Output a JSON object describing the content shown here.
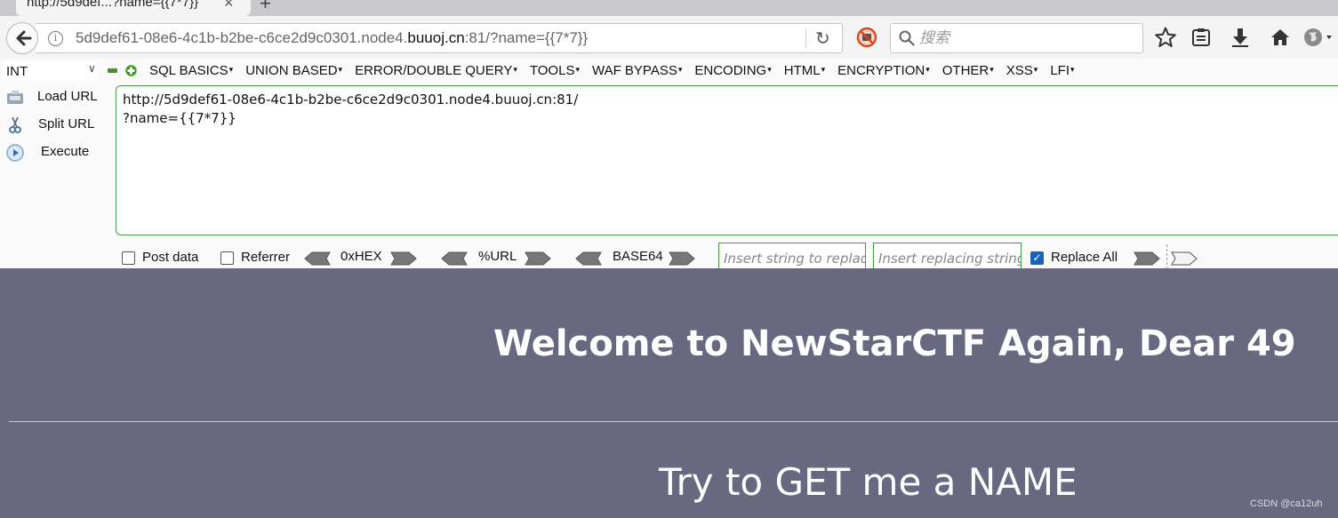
{
  "browser": {
    "tab_title": "http://5d9def...?name={{7*7}}",
    "url": {
      "prefix": "5d9def61-08e6-4c1b-b2be-c6ce2d9c0301.node4.",
      "domain": "buuoj.cn",
      "suffix": ":81/?name={{7*7}}"
    },
    "search_placeholder": "搜索",
    "icons": [
      "back-arrow-icon",
      "info-icon",
      "reload-icon",
      "block-icon",
      "search-icon",
      "star-icon",
      "reader-icon",
      "download-icon",
      "home-icon",
      "globe-icon"
    ]
  },
  "hackbar": {
    "select_value": "INT",
    "menu": [
      {
        "label": "SQL BASICS"
      },
      {
        "label": "UNION BASED"
      },
      {
        "label": "ERROR/DOUBLE QUERY"
      },
      {
        "label": "TOOLS"
      },
      {
        "label": "WAF BYPASS"
      },
      {
        "label": "ENCODING"
      },
      {
        "label": "HTML"
      },
      {
        "label": "ENCRYPTION"
      },
      {
        "label": "OTHER"
      },
      {
        "label": "XSS"
      },
      {
        "label": "LFI"
      }
    ],
    "side": {
      "load_url": "Load URL",
      "split_url": "Split URL",
      "execute": "Execute"
    },
    "textarea": "http://5d9def61-08e6-4c1b-b2be-c6ce2d9c0301.node4.buuoj.cn:81/\n?name={{7*7}}",
    "bottom": {
      "post_data": "Post data",
      "referrer": "Referrer",
      "hex": "0xHEX",
      "url": "%URL",
      "base64": "BASE64",
      "find_placeholder": "Insert string to replace",
      "replace_placeholder": "Insert replacing string",
      "replace_all": "Replace All",
      "replace_all_checked": true
    },
    "colors": {
      "accent_green": "#3d9a3d",
      "checkbox_blue": "#1565c0"
    }
  },
  "page": {
    "welcome": "Welcome to NewStarCTF Again, Dear 49",
    "subtitle": "Try to GET me a NAME",
    "watermark": "CSDN @ca12uh",
    "background": "#686881"
  }
}
